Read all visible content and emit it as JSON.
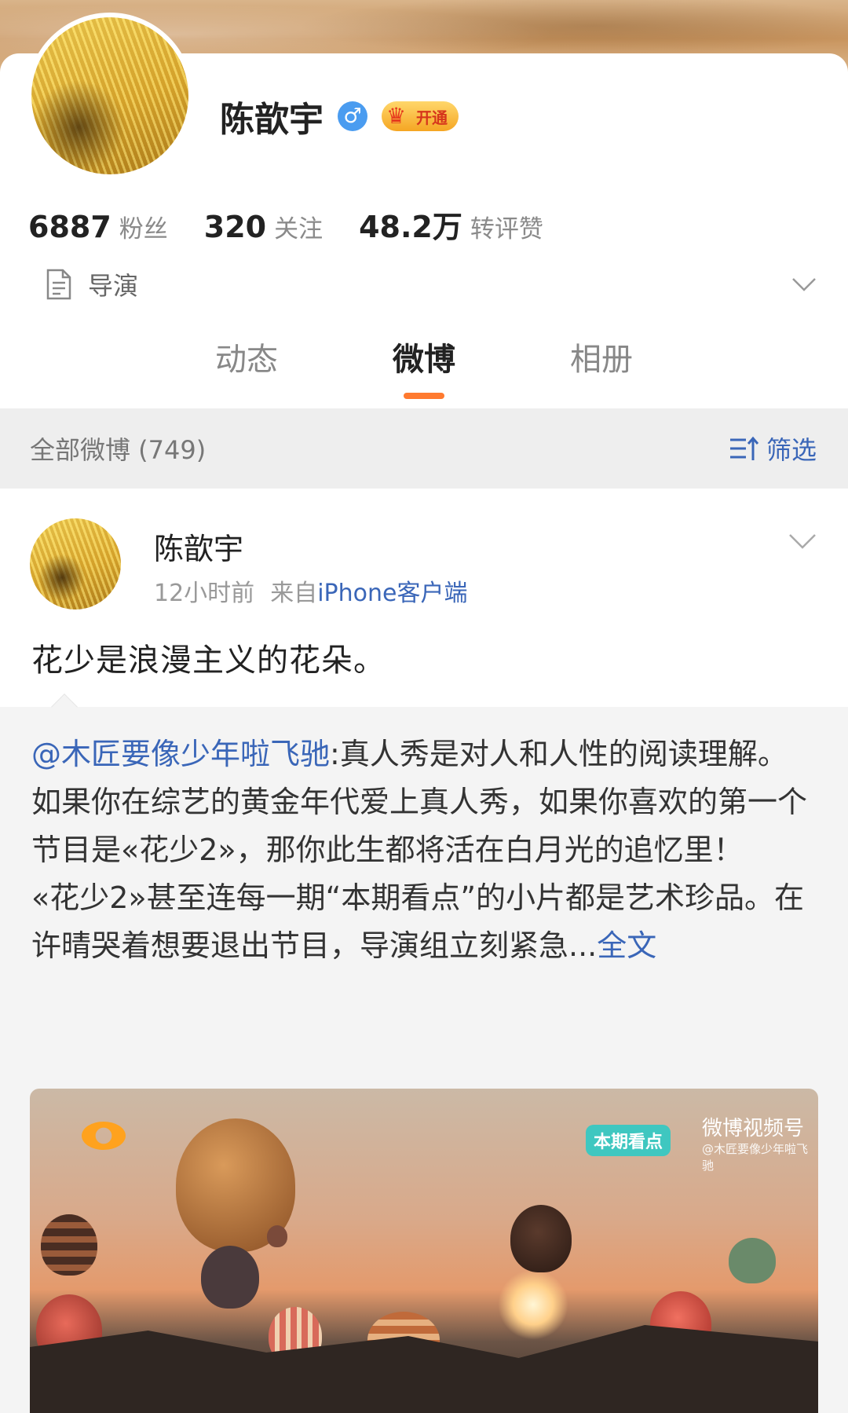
{
  "profile": {
    "name": "陈歆宇",
    "gender_symbol": "♂",
    "vip_label": "开通",
    "stats": [
      {
        "value": "6887",
        "label": "粉丝"
      },
      {
        "value": "320",
        "label": "关注"
      },
      {
        "value": "48.2万",
        "label": "转评赞"
      }
    ],
    "intro": "导演"
  },
  "tabs": [
    {
      "label": "动态",
      "active": false
    },
    {
      "label": "微博",
      "active": true
    },
    {
      "label": "相册",
      "active": false
    }
  ],
  "filter": {
    "title": "全部微博 (749)",
    "button_label": "筛选"
  },
  "post": {
    "author": "陈歆宇",
    "time": "12小时前",
    "source_prefix": "来自",
    "source_app": "iPhone客户端",
    "text": "花少是浪漫主义的花朵。",
    "repost": {
      "mention": "@木匠要像少年啦飞驰",
      "lines": [
        ":真人秀是对人和人性的阅读理解。",
        "如果你在综艺的黄金年代爱上真人秀，如果你喜欢的第一个节目是«花少2»，那你此生都将活在白月光的追忆里！",
        "«花少2»甚至连每一期“本期看点”的小片都是艺术珍品。在许晴哭着想要退出节目，导演组立刻紧急..."
      ],
      "read_more": "全文",
      "video": {
        "episode_tag": "本期看点",
        "brand": "微博视频号",
        "source": "@木匠要像少年啦飞驰"
      }
    }
  },
  "colors": {
    "link": "#3a66b8",
    "tab_indicator": "#ff7a2f",
    "gender_badge": "#4a9cf0",
    "vip_gold": "#f5a623"
  },
  "icons": [
    "gender-male-icon",
    "crown-icon",
    "document-icon",
    "chevron-down-icon",
    "filter-sort-icon",
    "more-chevron-icon"
  ]
}
